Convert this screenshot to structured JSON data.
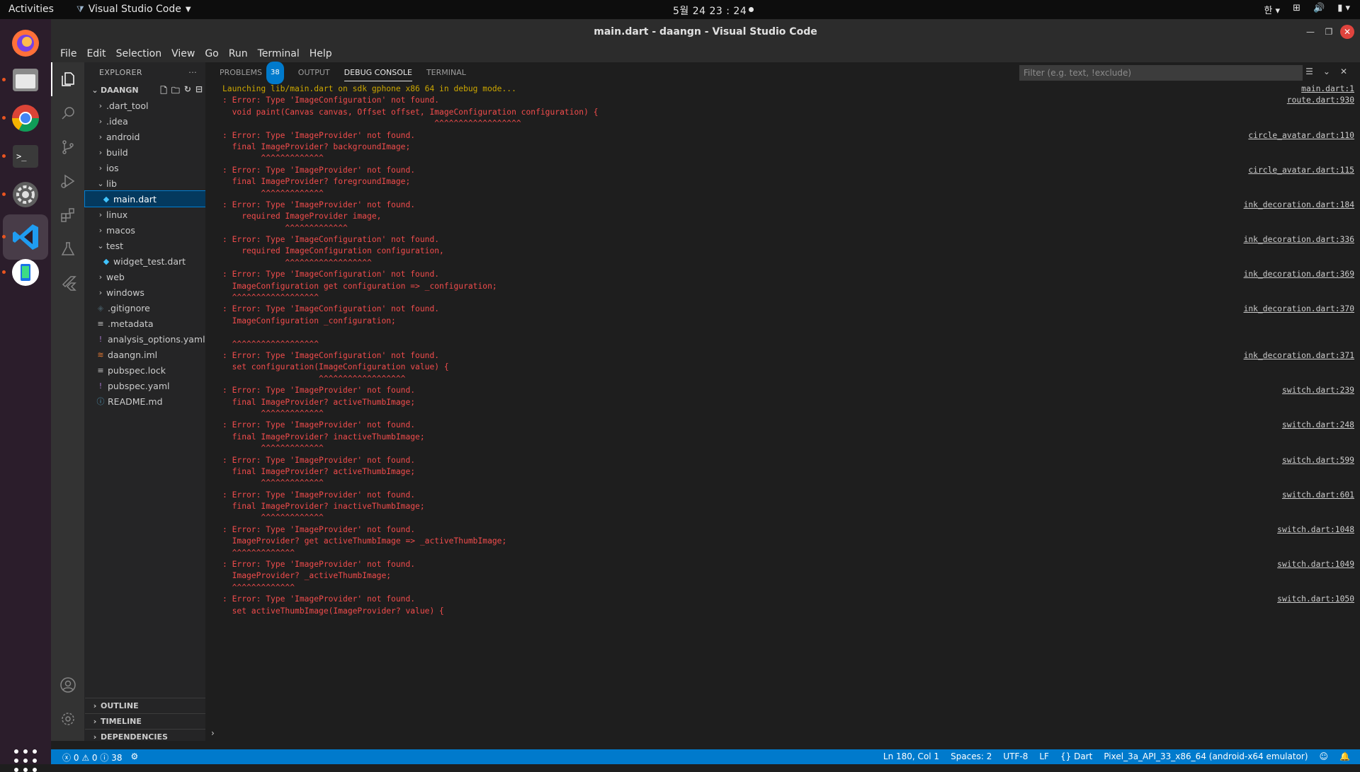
{
  "topbar": {
    "activities": "Activities",
    "app_name": "Visual Studio Code",
    "clock": "5월 24  23 : 24",
    "input_method": "한"
  },
  "window": {
    "title": "main.dart - daangn - Visual Studio Code"
  },
  "menubar": [
    "File",
    "Edit",
    "Selection",
    "View",
    "Go",
    "Run",
    "Terminal",
    "Help"
  ],
  "sidebar": {
    "header": "EXPLORER",
    "more": "···",
    "project": "DAANGN",
    "items": [
      {
        "label": ".dart_tool",
        "type": "folder",
        "open": false,
        "depth": 1
      },
      {
        "label": ".idea",
        "type": "folder",
        "open": false,
        "depth": 1
      },
      {
        "label": "android",
        "type": "folder",
        "open": false,
        "depth": 1
      },
      {
        "label": "build",
        "type": "folder",
        "open": false,
        "depth": 1
      },
      {
        "label": "ios",
        "type": "folder",
        "open": false,
        "depth": 1
      },
      {
        "label": "lib",
        "type": "folder",
        "open": true,
        "depth": 1
      },
      {
        "label": "main.dart",
        "type": "dart",
        "depth": 2,
        "selected": true
      },
      {
        "label": "linux",
        "type": "folder",
        "open": false,
        "depth": 1
      },
      {
        "label": "macos",
        "type": "folder",
        "open": false,
        "depth": 1
      },
      {
        "label": "test",
        "type": "folder",
        "open": true,
        "depth": 1
      },
      {
        "label": "widget_test.dart",
        "type": "dart",
        "depth": 2
      },
      {
        "label": "web",
        "type": "folder",
        "open": false,
        "depth": 1
      },
      {
        "label": "windows",
        "type": "folder",
        "open": false,
        "depth": 1
      },
      {
        "label": ".gitignore",
        "type": "git",
        "depth": 1
      },
      {
        "label": ".metadata",
        "type": "lines",
        "depth": 1
      },
      {
        "label": "analysis_options.yaml",
        "type": "yaml",
        "depth": 1
      },
      {
        "label": "daangn.iml",
        "type": "rss",
        "depth": 1
      },
      {
        "label": "pubspec.lock",
        "type": "lines",
        "depth": 1
      },
      {
        "label": "pubspec.yaml",
        "type": "yaml",
        "depth": 1
      },
      {
        "label": "README.md",
        "type": "info",
        "depth": 1
      }
    ],
    "sections": [
      "OUTLINE",
      "TIMELINE",
      "DEPENDENCIES"
    ]
  },
  "panel": {
    "tabs": [
      "PROBLEMS",
      "OUTPUT",
      "DEBUG CONSOLE",
      "TERMINAL"
    ],
    "problems_count": "38",
    "active_tab": "DEBUG CONSOLE",
    "filter_placeholder": "Filter (e.g. text, !exclude)",
    "lines": [
      {
        "text": "Launching lib/main.dart on sdk gphone x86 64 in debug mode...",
        "kind": "launch",
        "link": "main.dart:1"
      },
      {
        "text": ": Error: Type 'ImageConfiguration' not found.",
        "kind": "err",
        "link": "route.dart:930"
      },
      {
        "text": "  void paint(Canvas canvas, Offset offset, ImageConfiguration configuration) {",
        "kind": "err",
        "link": ""
      },
      {
        "text": "                                            ^^^^^^^^^^^^^^^^^^",
        "kind": "err",
        "link": ""
      },
      {
        "text": ": Error: Type 'ImageProvider' not found.",
        "kind": "err",
        "link": "circle_avatar.dart:110"
      },
      {
        "text": "  final ImageProvider? backgroundImage;",
        "kind": "err",
        "link": ""
      },
      {
        "text": "        ^^^^^^^^^^^^^",
        "kind": "err",
        "link": ""
      },
      {
        "text": ": Error: Type 'ImageProvider' not found.",
        "kind": "err",
        "link": "circle_avatar.dart:115"
      },
      {
        "text": "  final ImageProvider? foregroundImage;",
        "kind": "err",
        "link": ""
      },
      {
        "text": "        ^^^^^^^^^^^^^",
        "kind": "err",
        "link": ""
      },
      {
        "text": ": Error: Type 'ImageProvider' not found.",
        "kind": "err",
        "link": "ink_decoration.dart:184"
      },
      {
        "text": "    required ImageProvider image,",
        "kind": "err",
        "link": ""
      },
      {
        "text": "             ^^^^^^^^^^^^^",
        "kind": "err",
        "link": ""
      },
      {
        "text": ": Error: Type 'ImageConfiguration' not found.",
        "kind": "err",
        "link": "ink_decoration.dart:336"
      },
      {
        "text": "    required ImageConfiguration configuration,",
        "kind": "err",
        "link": ""
      },
      {
        "text": "             ^^^^^^^^^^^^^^^^^^",
        "kind": "err",
        "link": ""
      },
      {
        "text": ": Error: Type 'ImageConfiguration' not found.",
        "kind": "err",
        "link": "ink_decoration.dart:369"
      },
      {
        "text": "  ImageConfiguration get configuration => _configuration;",
        "kind": "err",
        "link": ""
      },
      {
        "text": "  ^^^^^^^^^^^^^^^^^^",
        "kind": "err",
        "link": ""
      },
      {
        "text": ": Error: Type 'ImageConfiguration' not found.",
        "kind": "err",
        "link": "ink_decoration.dart:370"
      },
      {
        "text": "  ImageConfiguration _configuration;",
        "kind": "err",
        "link": ""
      },
      {
        "text": "",
        "kind": "err",
        "link": ""
      },
      {
        "text": "  ^^^^^^^^^^^^^^^^^^",
        "kind": "err",
        "link": ""
      },
      {
        "text": ": Error: Type 'ImageConfiguration' not found.",
        "kind": "err",
        "link": "ink_decoration.dart:371"
      },
      {
        "text": "  set configuration(ImageConfiguration value) {",
        "kind": "err",
        "link": ""
      },
      {
        "text": "                    ^^^^^^^^^^^^^^^^^^",
        "kind": "err",
        "link": ""
      },
      {
        "text": ": Error: Type 'ImageProvider' not found.",
        "kind": "err",
        "link": "switch.dart:239"
      },
      {
        "text": "  final ImageProvider? activeThumbImage;",
        "kind": "err",
        "link": ""
      },
      {
        "text": "        ^^^^^^^^^^^^^",
        "kind": "err",
        "link": ""
      },
      {
        "text": ": Error: Type 'ImageProvider' not found.",
        "kind": "err",
        "link": "switch.dart:248"
      },
      {
        "text": "  final ImageProvider? inactiveThumbImage;",
        "kind": "err",
        "link": ""
      },
      {
        "text": "        ^^^^^^^^^^^^^",
        "kind": "err",
        "link": ""
      },
      {
        "text": ": Error: Type 'ImageProvider' not found.",
        "kind": "err",
        "link": "switch.dart:599"
      },
      {
        "text": "  final ImageProvider? activeThumbImage;",
        "kind": "err",
        "link": ""
      },
      {
        "text": "        ^^^^^^^^^^^^^",
        "kind": "err",
        "link": ""
      },
      {
        "text": ": Error: Type 'ImageProvider' not found.",
        "kind": "err",
        "link": "switch.dart:601"
      },
      {
        "text": "  final ImageProvider? inactiveThumbImage;",
        "kind": "err",
        "link": ""
      },
      {
        "text": "        ^^^^^^^^^^^^^",
        "kind": "err",
        "link": ""
      },
      {
        "text": ": Error: Type 'ImageProvider' not found.",
        "kind": "err",
        "link": "switch.dart:1048"
      },
      {
        "text": "  ImageProvider? get activeThumbImage => _activeThumbImage;",
        "kind": "err",
        "link": ""
      },
      {
        "text": "  ^^^^^^^^^^^^^",
        "kind": "err",
        "link": ""
      },
      {
        "text": ": Error: Type 'ImageProvider' not found.",
        "kind": "err",
        "link": "switch.dart:1049"
      },
      {
        "text": "  ImageProvider? _activeThumbImage;",
        "kind": "err",
        "link": ""
      },
      {
        "text": "  ^^^^^^^^^^^^^",
        "kind": "err",
        "link": ""
      },
      {
        "text": ": Error: Type 'ImageProvider' not found.",
        "kind": "err",
        "link": "switch.dart:1050"
      },
      {
        "text": "  set activeThumbImage(ImageProvider? value) {",
        "kind": "err",
        "link": ""
      }
    ]
  },
  "statusbar": {
    "errors": "0",
    "warnings": "0",
    "infos": "38",
    "position": "Ln 180, Col 1",
    "spaces": "Spaces: 2",
    "encoding": "UTF-8",
    "eol": "LF",
    "language": "Dart",
    "device": "Pixel_3a_API_33_x86_64 (android-x64 emulator)"
  },
  "colors": {
    "accent": "#007acc",
    "error_text": "#f14c4c",
    "launch_text": "#cca700",
    "dock_bg": "#2b1d2b"
  }
}
